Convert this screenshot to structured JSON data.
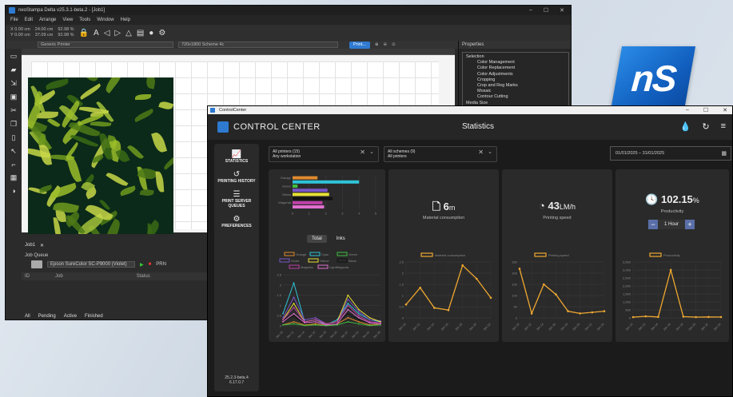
{
  "back_window": {
    "title": "neoStampa Delta  v25.3.1-beta.2 - [Job1]",
    "menu": [
      "File",
      "Edit",
      "Arrange",
      "View",
      "Tools",
      "Window",
      "Help"
    ],
    "toolbar": {
      "x": "X  0.00 cm",
      "y": "Y  0.00 cm",
      "w": "24.00 cm",
      "h": "37.09 cm",
      "sx": "92.98 %",
      "sy": "92.98 %"
    },
    "printer_combo": "Generic Printer",
    "scheme_combo": "720x1800 Scheme 4c",
    "print_button": "Print...",
    "properties_title": "Properties",
    "properties": {
      "root": "Selection",
      "items": [
        "Color Management",
        "Color Replacement",
        "Color Adjustments",
        "Cropping",
        "Crop and Reg Marks",
        "Mosaic",
        "Contour Cutting"
      ],
      "last": "Media Size"
    },
    "job_tab": "Job1",
    "job_queue": "Job Queue",
    "queue_printer": "Epson SureColor SC-P9000 (Violet)",
    "prn_label": "PRN",
    "queue_cols": [
      "ID",
      "Job",
      "Status"
    ],
    "queue_footer": [
      "All",
      "Pending",
      "Active",
      "Finished"
    ]
  },
  "logo": {
    "text": "nS"
  },
  "front_window": {
    "os_title": "ControlCenter",
    "app_title": "CONTROL CENTER",
    "page_title": "Statistics",
    "sidebar": [
      {
        "icon": "chart-icon",
        "label": "STATISTICS"
      },
      {
        "icon": "history-icon",
        "label": "PRINTING HISTORY"
      },
      {
        "icon": "list-icon",
        "label": "PRINT SERVER QUEUES"
      },
      {
        "icon": "gear-icon",
        "label": "PREFERENCES"
      }
    ],
    "version": [
      "25.2.3-beta.4",
      "6.17.0.7"
    ],
    "filter_printers": {
      "line1": "All printers (15)",
      "line2": "Any workstation"
    },
    "filter_schemes": {
      "line1": "All schemes (9)",
      "line2": "All printers"
    },
    "date_range": "01/01/2025 – 31/01/2025",
    "ink_toggle": {
      "total": "Total",
      "inks": "Inks"
    },
    "material": {
      "value": "6",
      "unit": "m",
      "label": "Material consumption"
    },
    "speed": {
      "value": "43",
      "unit": "LM/h",
      "label": "Printing speed"
    },
    "productivity": {
      "value": "102.15",
      "unit": "%",
      "label": "Productivity",
      "interval": "1 Hour"
    }
  },
  "chart_data": [
    {
      "type": "bar",
      "orientation": "horizontal",
      "categories": [
        "Orange",
        "Cyan",
        "Green",
        "Violet",
        "Yellow",
        "Black",
        "Magenta",
        "LightMagenta"
      ],
      "values": [
        1.5,
        4.0,
        0.3,
        2.1,
        2.2,
        2.4,
        1.8,
        1.9
      ],
      "colors": [
        "#e08a2e",
        "#2fc4d8",
        "#3fbf3f",
        "#7a55c8",
        "#e8e035",
        "#111111",
        "#c040a8",
        "#e070d0"
      ],
      "xlim": [
        0,
        5
      ],
      "xticks": [
        "0",
        "1",
        "2",
        "3",
        "4",
        "5"
      ]
    },
    {
      "type": "line",
      "x": [
        "Jan 10",
        "Jan 12",
        "Jan 14",
        "Jan 16",
        "Jan 18",
        "Jan 20",
        "Jan 22",
        "Jan 24",
        "Jan 26",
        "Jan 28"
      ],
      "ylim": [
        0,
        2.5
      ],
      "yticks": [
        "0",
        "0.5",
        "1",
        "1.5",
        "2",
        "2.5"
      ],
      "legend": [
        "Orange",
        "Cyan",
        "Green",
        "Violet",
        "Yellow",
        "Black",
        "Magenta",
        "LightMagenta"
      ],
      "series": [
        {
          "name": "Orange",
          "color": "#e08a2e",
          "values": [
            0.05,
            0.2,
            0.05,
            0.1,
            0.02,
            0.1,
            0.4,
            0.2,
            0.05,
            0.1
          ]
        },
        {
          "name": "Cyan",
          "color": "#2fc4d8",
          "values": [
            0.6,
            2.1,
            0.2,
            0.3,
            0.05,
            0.3,
            1.1,
            0.6,
            0.3,
            0.2
          ]
        },
        {
          "name": "Green",
          "color": "#3fbf3f",
          "values": [
            0.05,
            0.1,
            0.02,
            0.05,
            0.01,
            0.05,
            0.2,
            0.1,
            0.02,
            0.05
          ]
        },
        {
          "name": "Violet",
          "color": "#7a55c8",
          "values": [
            0.4,
            1.4,
            0.3,
            0.4,
            0.1,
            0.2,
            1.3,
            0.7,
            0.3,
            0.25
          ]
        },
        {
          "name": "Yellow",
          "color": "#e8e035",
          "values": [
            0.3,
            1.1,
            0.2,
            0.3,
            0.1,
            0.2,
            1.5,
            0.8,
            0.4,
            0.2
          ]
        },
        {
          "name": "Black",
          "color": "#111111",
          "values": [
            0.2,
            0.5,
            0.1,
            0.2,
            0.05,
            0.15,
            0.6,
            0.3,
            0.15,
            0.1
          ]
        },
        {
          "name": "Magenta",
          "color": "#c040a8",
          "values": [
            0.3,
            0.9,
            0.2,
            0.3,
            0.1,
            0.2,
            1.0,
            0.5,
            0.2,
            0.15
          ]
        },
        {
          "name": "LightMagenta",
          "color": "#e070d0",
          "values": [
            0.2,
            0.6,
            0.15,
            0.2,
            0.05,
            0.1,
            0.8,
            0.4,
            0.15,
            0.1
          ]
        }
      ]
    },
    {
      "type": "line",
      "legend": [
        "Material consumption"
      ],
      "x": [
        "Jan 10",
        "Jan 12",
        "Jan 14",
        "Jan 16",
        "Jan 18",
        "Jan 20",
        "Jan 22"
      ],
      "ylim": [
        0,
        2.5
      ],
      "yticks": [
        "0",
        "0.5",
        "1",
        "1.5",
        "2",
        "2.5"
      ],
      "series": [
        {
          "name": "Material consumption",
          "color": "#f0a830",
          "values": [
            0.6,
            1.35,
            0.45,
            0.35,
            2.35,
            1.75,
            0.9
          ]
        }
      ]
    },
    {
      "type": "line",
      "legend": [
        "Printing speed"
      ],
      "x": [
        "Jan 10",
        "Jan 12",
        "Jan 14",
        "Jan 16",
        "Jan 18",
        "Jan 20",
        "Jan 22",
        "Jan 24"
      ],
      "ylim": [
        0,
        250
      ],
      "yticks": [
        "0",
        "50",
        "100",
        "150",
        "200",
        "250"
      ],
      "series": [
        {
          "name": "Printing speed",
          "color": "#f0a830",
          "values": [
            220,
            20,
            150,
            105,
            30,
            20,
            25,
            30
          ]
        }
      ]
    },
    {
      "type": "line",
      "legend": [
        "Productivity"
      ],
      "x": [
        "Jan 10",
        "Jan 12",
        "Jan 14",
        "Jan 16",
        "Jan 18",
        "Jan 20",
        "Jan 22",
        "Jan 24"
      ],
      "ylim": [
        0,
        3500
      ],
      "yticks": [
        "0",
        "500",
        "1,000",
        "1,500",
        "2,000",
        "2,500",
        "3,000",
        "3,500"
      ],
      "series": [
        {
          "name": "Productivity",
          "color": "#f0a830",
          "values": [
            50,
            100,
            60,
            3000,
            80,
            50,
            60,
            55
          ]
        }
      ]
    }
  ]
}
